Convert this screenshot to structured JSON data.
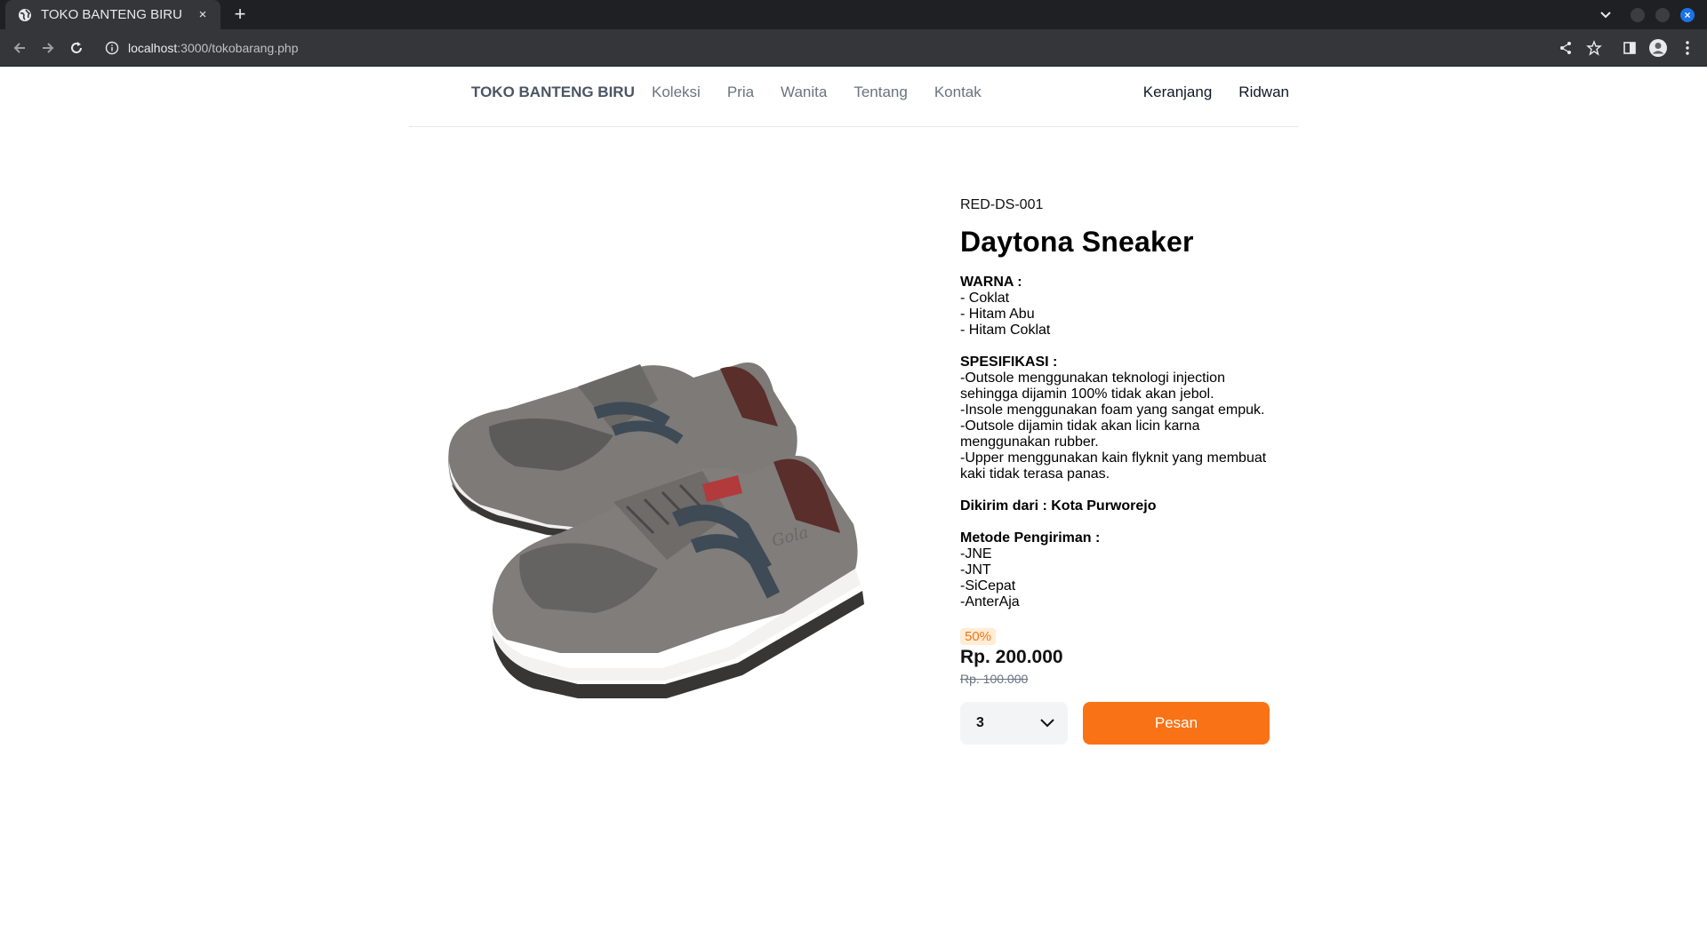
{
  "browser": {
    "tab_title": "TOKO BANTENG BIRU",
    "tab_close": "×",
    "new_tab": "+",
    "url_host": "localhost",
    "url_rest": ":3000/tokobarang.php",
    "close_glyph": "×"
  },
  "nav": {
    "brand": "TOKO BANTENG BIRU",
    "links": [
      "Koleksi",
      "Pria",
      "Wanita",
      "Tentang",
      "Kontak"
    ],
    "cart": "Keranjang",
    "user": "Ridwan"
  },
  "product": {
    "sku": "RED-DS-001",
    "name": "Daytona Sneaker",
    "color_heading": "WARNA :",
    "colors": [
      "- Coklat",
      "- Hitam Abu",
      "- Hitam Coklat"
    ],
    "spec_heading": "SPESIFIKASI :",
    "specs": [
      "-Outsole menggunakan teknologi injection sehingga dijamin 100% tidak akan jebol.",
      "-Insole menggunakan foam yang sangat empuk.",
      "-Outsole dijamin tidak akan licin karna menggunakan rubber.",
      "-Upper menggunakan kain flyknit yang membuat kaki tidak terasa panas."
    ],
    "shipped_from": "Dikirim dari : Kota Purworejo",
    "shipping_heading": "Metode Pengiriman :",
    "shipping_methods": [
      "-JNE",
      "-JNT",
      "-SiCepat",
      "-AnterAja"
    ],
    "discount": "50%",
    "price": "Rp. 200.000",
    "old_price": "Rp. 100.000",
    "quantity": "3",
    "order_label": "Pesan",
    "accent_color": "#f97316"
  }
}
